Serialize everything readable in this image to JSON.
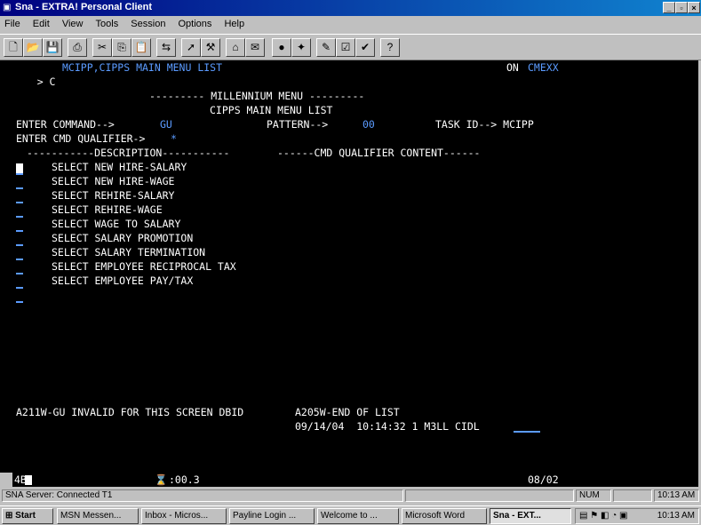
{
  "window": {
    "title": "Sna - EXTRA! Personal Client",
    "controls": [
      "minimize-icon",
      "maximize-icon",
      "close-icon"
    ]
  },
  "menubar": {
    "items": [
      "File",
      "Edit",
      "View",
      "Tools",
      "Session",
      "Options",
      "Help"
    ]
  },
  "toolbar": {
    "icons": [
      "new-icon",
      "open-icon",
      "save-icon",
      "print-icon",
      "cut-icon",
      "copy-icon",
      "paste-icon",
      "transfer-icon",
      "send-icon",
      "macro-icon",
      "tools-icon",
      "connect-icon",
      "disconnect-icon",
      "record-icon",
      "stop-icon",
      "settings-icon",
      "edit-icon",
      "check-icon",
      "help-icon"
    ]
  },
  "terminal": {
    "header_prompt": "> C",
    "header_title": "MCIPP,CIPPS MAIN MENU LIST",
    "header_on": "ON",
    "header_system": "CMEXX",
    "menu_title": "--------- MILLENNIUM MENU ---------",
    "menu_subtitle": "CIPPS MAIN MENU LIST",
    "enter_command_label": "ENTER COMMAND-->",
    "enter_command_value": "GU",
    "pattern_label": "PATTERN-->",
    "pattern_value": "00",
    "task_id_label": "TASK ID--> MCIPP",
    "qualifier_label": "ENTER CMD QUALIFIER->",
    "qualifier_value": "*",
    "col_description": "-----------DESCRIPTION-----------",
    "col_qualifier": "------CMD QUALIFIER CONTENT------",
    "items": [
      "SELECT NEW HIRE-SALARY",
      "SELECT NEW HIRE-WAGE",
      "SELECT REHIRE-SALARY",
      "SELECT REHIRE-WAGE",
      "SELECT WAGE TO SALARY",
      "SELECT SALARY PROMOTION",
      "SELECT SALARY TERMINATION",
      "SELECT EMPLOYEE RECIPROCAL TAX",
      "SELECT EMPLOYEE PAY/TAX"
    ],
    "message_left": "A211W-GU INVALID FOR THIS SCREEN DBID",
    "message_right": "A205W-END OF LIST",
    "timestamp_line": "09/14/04  10:14:32 1 M3LL CIDL"
  },
  "oia": {
    "session_indicator": "4B",
    "timer": ":00.3",
    "cursor_pos": "08/02"
  },
  "status": {
    "server": "SNA Server: Connected T1",
    "num": "NUM",
    "time": "10:13 AM"
  },
  "taskbar": {
    "start": "Start",
    "buttons": [
      "MSN Messen...",
      "Inbox - Micros...",
      "Payline Login ...",
      "Welcome to ...",
      "Microsoft Word",
      "Sna - EXT..."
    ],
    "clock": "10:13 AM"
  }
}
